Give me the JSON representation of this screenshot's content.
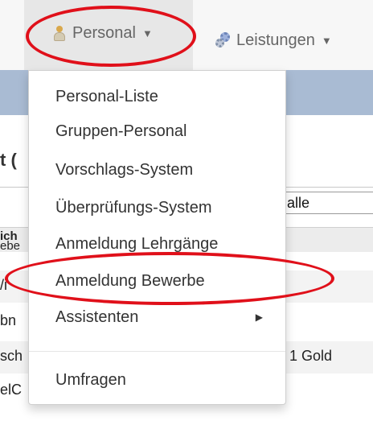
{
  "navbar": {
    "personal": {
      "label": "Personal",
      "icon": "person-icon"
    },
    "services": {
      "label": "Leistungen",
      "icon": "gear-icon"
    }
  },
  "page": {
    "title_fragment": "t (",
    "filter_value": "alle",
    "header_fragment_1": "ich",
    "header_fragment_2": "ebe",
    "rows": [
      {
        "left": "/i",
        "right": ""
      },
      {
        "left": "bn",
        "right": ""
      },
      {
        "left": "sch",
        "right": "1 Gold"
      },
      {
        "left": "elC",
        "right": ""
      }
    ]
  },
  "dropdown": {
    "items": [
      {
        "label": "Personal-Liste"
      },
      {
        "label": "Gruppen-Personal"
      },
      {
        "label": "Vorschlags-System"
      },
      {
        "label": "Überprüfungs-System"
      },
      {
        "label": "Anmeldung Lehrgänge"
      },
      {
        "label": "Anmeldung Bewerbe"
      },
      {
        "label": "Assistenten",
        "has_submenu": true
      },
      {
        "label": "Umfragen"
      }
    ]
  },
  "colors": {
    "highlight_ellipse": "#e0101a",
    "navbar_bg": "#f7f7f7",
    "active_nav_bg": "#e7e7e7",
    "band_blue": "#a9bbd3"
  }
}
